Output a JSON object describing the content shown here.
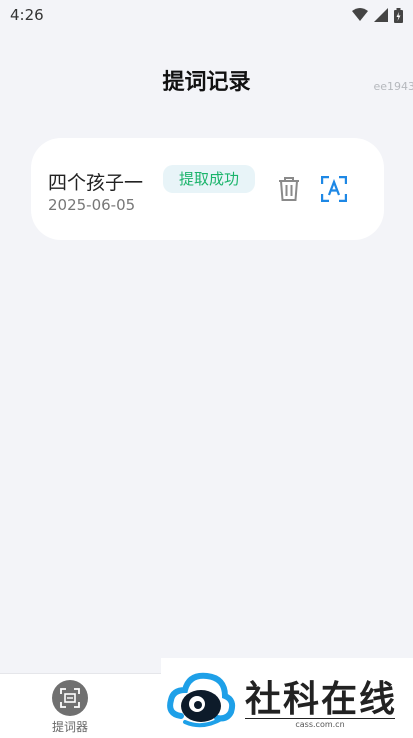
{
  "status_bar": {
    "time": "4:26"
  },
  "header": {
    "title": "提词记录",
    "device_id": "ee1943"
  },
  "records": [
    {
      "name": "四个孩子一",
      "status": "提取成功",
      "date": "2025-06-05"
    }
  ],
  "bottom_nav": {
    "items": [
      {
        "label": "提词器",
        "icon": "teleprompter-icon"
      }
    ]
  },
  "watermark": {
    "brand": "社科在线",
    "url": "cass.com.cn"
  },
  "colors": {
    "success": "#1bb46b",
    "accent": "#1e88e5",
    "background": "#f3f4f8"
  }
}
